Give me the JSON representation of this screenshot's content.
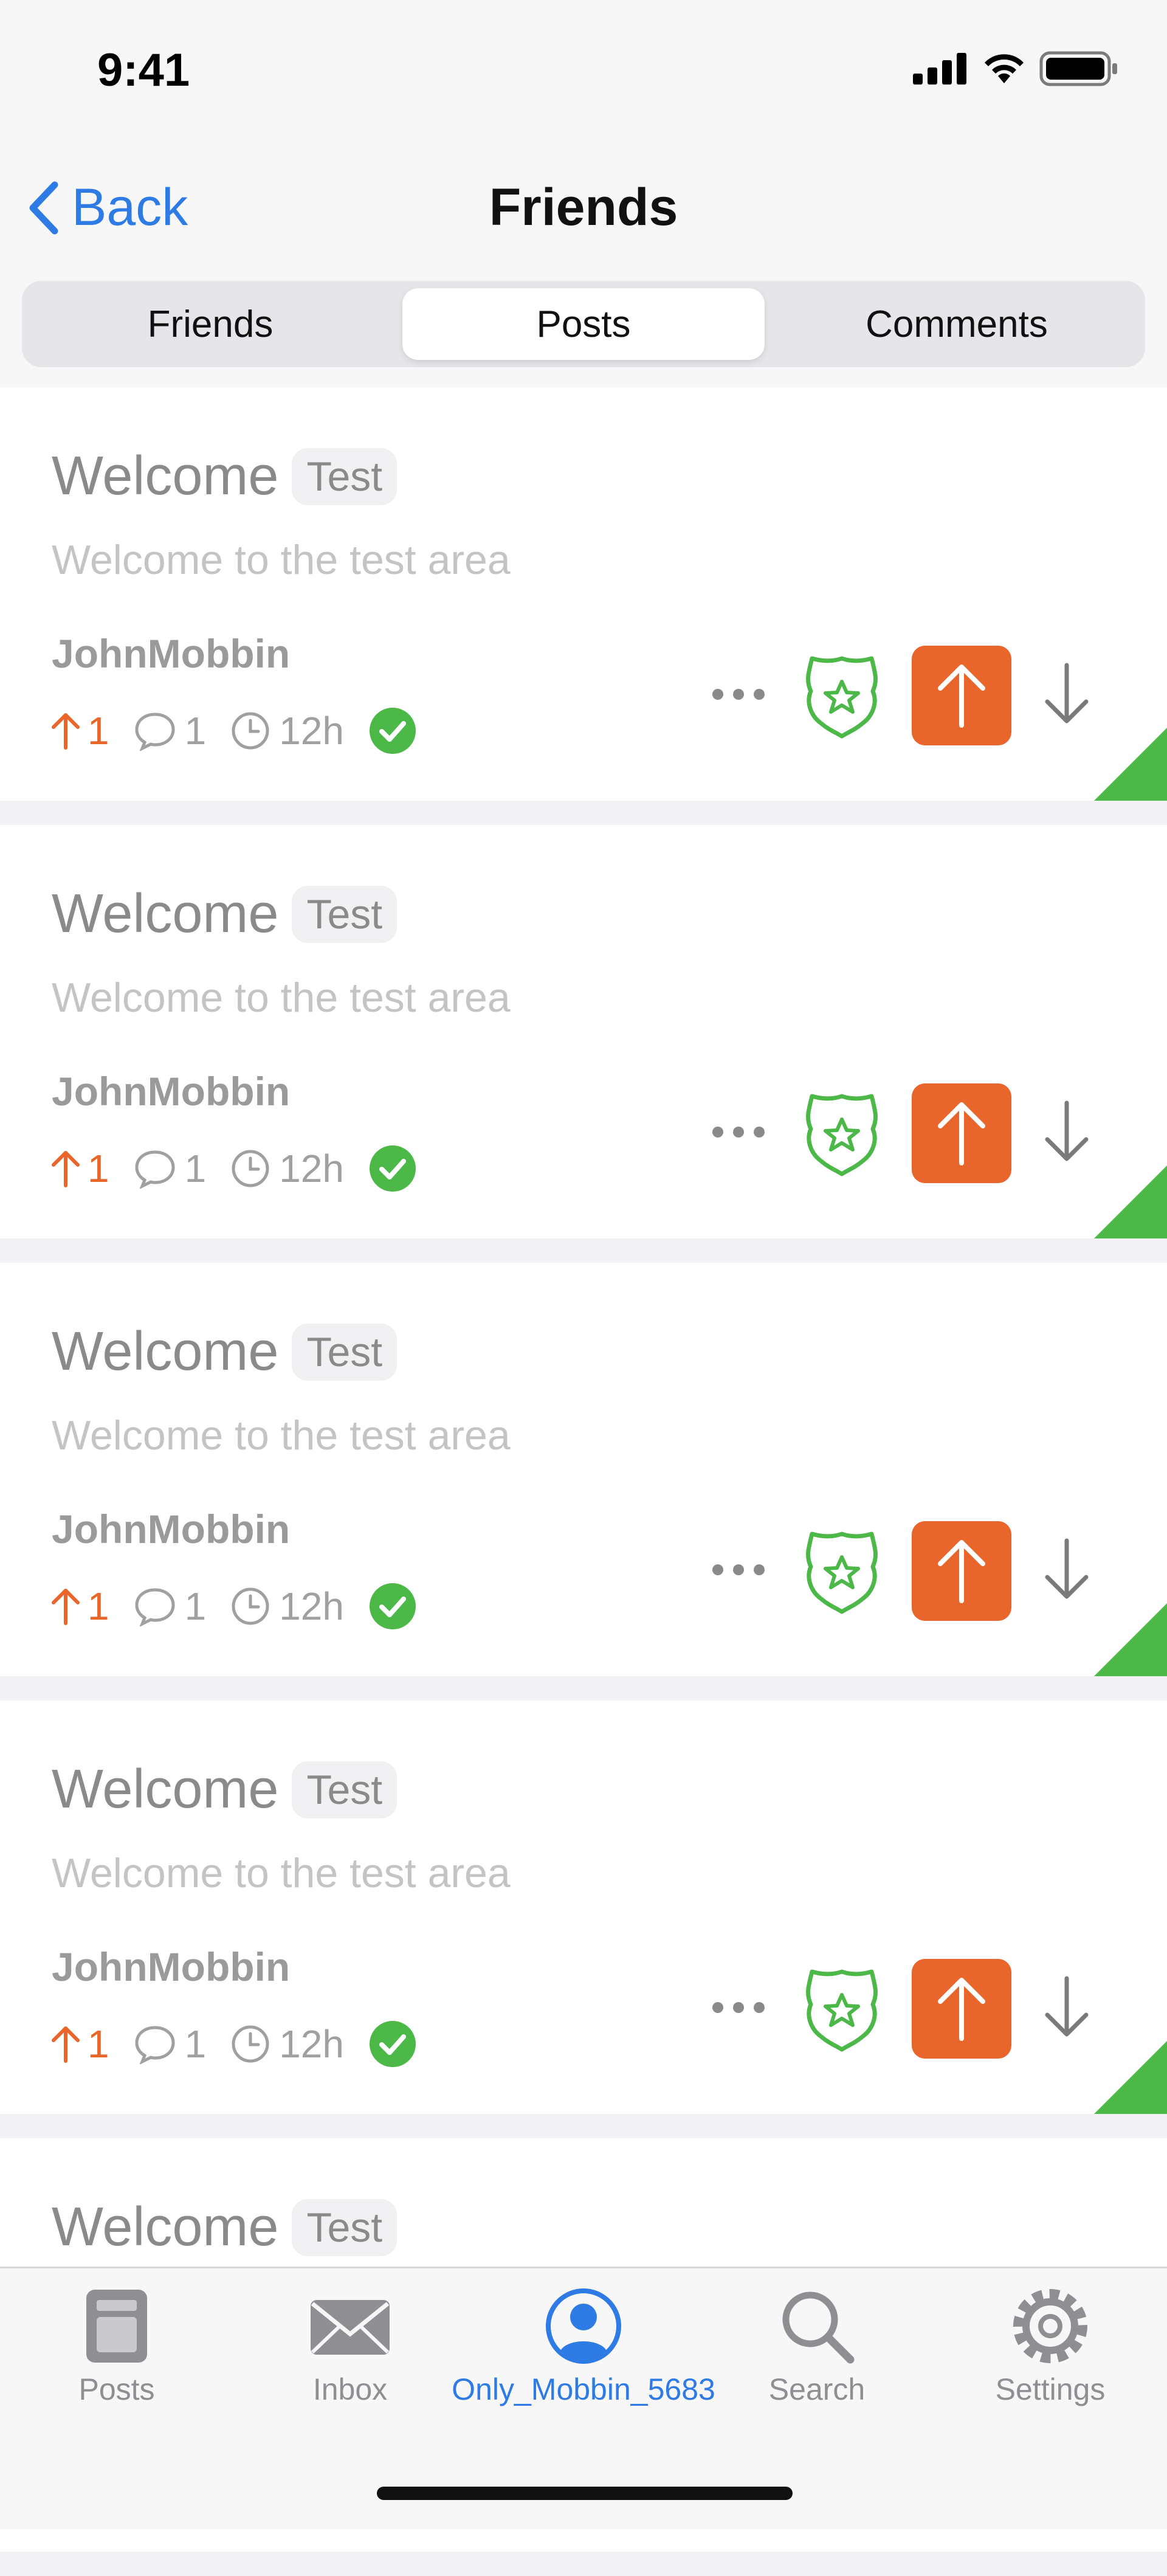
{
  "status_bar": {
    "time": "9:41"
  },
  "nav": {
    "back_label": "Back",
    "title": "Friends"
  },
  "segments": [
    {
      "label": "Friends",
      "active": false
    },
    {
      "label": "Posts",
      "active": true
    },
    {
      "label": "Comments",
      "active": false
    }
  ],
  "posts": [
    {
      "title": "Welcome",
      "tag": "Test",
      "body": "Welcome to the test area",
      "author": "JohnMobbin",
      "score": "1",
      "comments": "1",
      "age": "12h"
    },
    {
      "title": "Welcome",
      "tag": "Test",
      "body": "Welcome to the test area",
      "author": "JohnMobbin",
      "score": "1",
      "comments": "1",
      "age": "12h"
    },
    {
      "title": "Welcome",
      "tag": "Test",
      "body": "Welcome to the test area",
      "author": "JohnMobbin",
      "score": "1",
      "comments": "1",
      "age": "12h"
    },
    {
      "title": "Welcome",
      "tag": "Test",
      "body": "Welcome to the test area",
      "author": "JohnMobbin",
      "score": "1",
      "comments": "1",
      "age": "12h"
    },
    {
      "title": "Welcome",
      "tag": "Test",
      "body": "",
      "author": "",
      "score": "",
      "comments": "",
      "age": ""
    }
  ],
  "tabs": [
    {
      "label": "Posts",
      "icon": "posts-icon"
    },
    {
      "label": "Inbox",
      "icon": "inbox-icon"
    },
    {
      "label": "Only_Mobbin_5683",
      "icon": "profile-icon",
      "active": true
    },
    {
      "label": "Search",
      "icon": "search-icon"
    },
    {
      "label": "Settings",
      "icon": "gear-icon"
    }
  ],
  "colors": {
    "accent": "#2f7be5",
    "upvote": "#e8652c",
    "success": "#4cb847",
    "badge": "#4cb847"
  }
}
